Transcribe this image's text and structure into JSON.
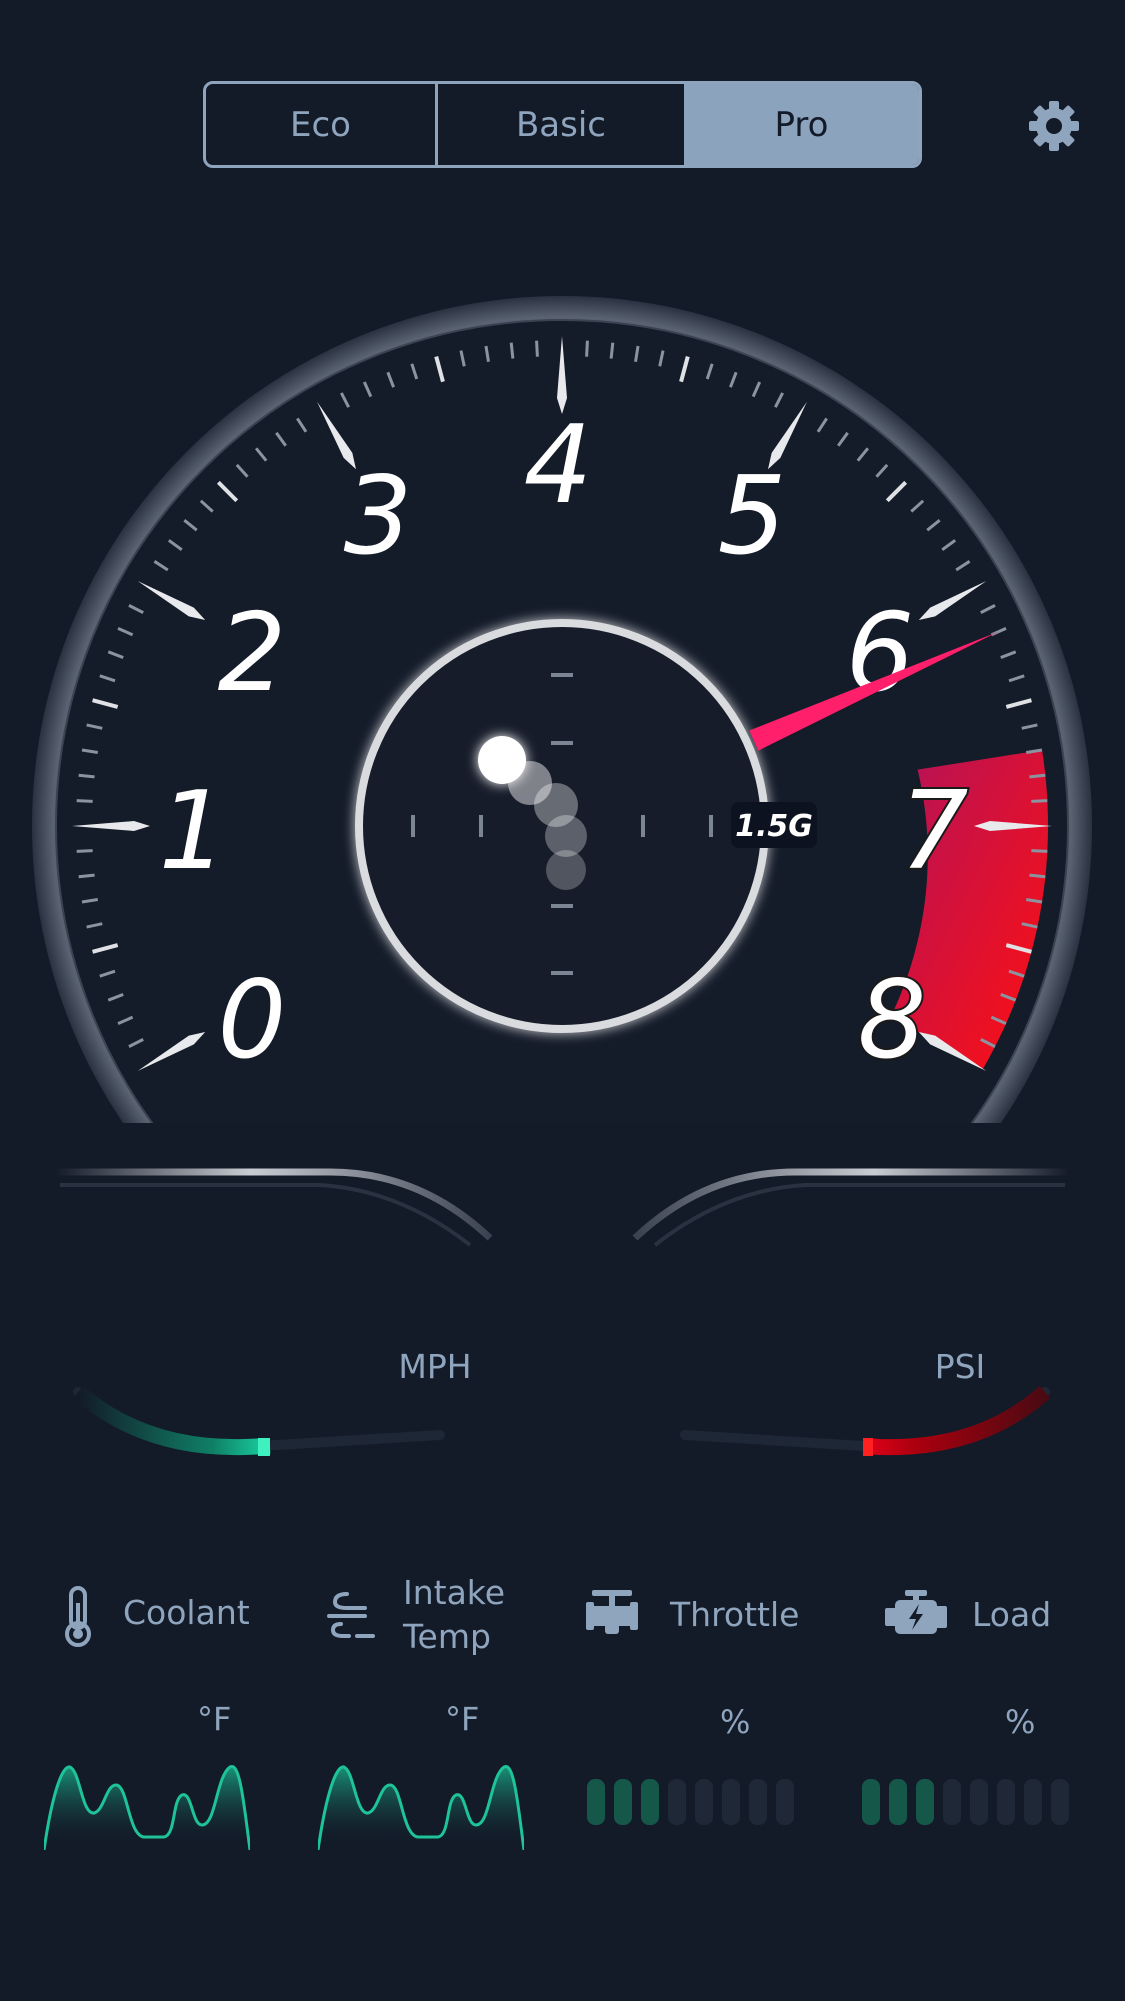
{
  "modes": {
    "tabs": [
      "Eco",
      "Basic",
      "Pro"
    ],
    "selected": "Pro"
  },
  "settings_icon": "gear-icon",
  "tachometer": {
    "labels": [
      "0",
      "1",
      "2",
      "3",
      "4",
      "5",
      "6",
      "7",
      "8"
    ],
    "needle_value": 6.2,
    "redline_start": 6.7,
    "needle_color": "#ff1f6b",
    "redline_color": "#e0003a"
  },
  "g_meter": {
    "readout": "1.5G"
  },
  "speed": {
    "unit": "MPH",
    "level": 0.45,
    "color": "#19d3a2"
  },
  "boost": {
    "unit": "PSI",
    "level": 0.45,
    "color": "#e0001a"
  },
  "stats": [
    {
      "label_lines": [
        "Coolant"
      ],
      "icon": "thermometer-icon",
      "unit": "°F"
    },
    {
      "label_lines": [
        "Intake",
        "Temp"
      ],
      "icon": "wind-icon",
      "unit": "°F"
    },
    {
      "label_lines": [
        "Throttle"
      ],
      "icon": "throttle-valve-icon",
      "unit": "%",
      "segments_on": 3,
      "segments_total": 8
    },
    {
      "label_lines": [
        "Load"
      ],
      "icon": "engine-icon",
      "unit": "%",
      "segments_on": 3,
      "segments_total": 8
    }
  ],
  "colors": {
    "background": "#131a28",
    "text_muted": "#8fa4bd",
    "accent_green": "#19d3a2"
  }
}
